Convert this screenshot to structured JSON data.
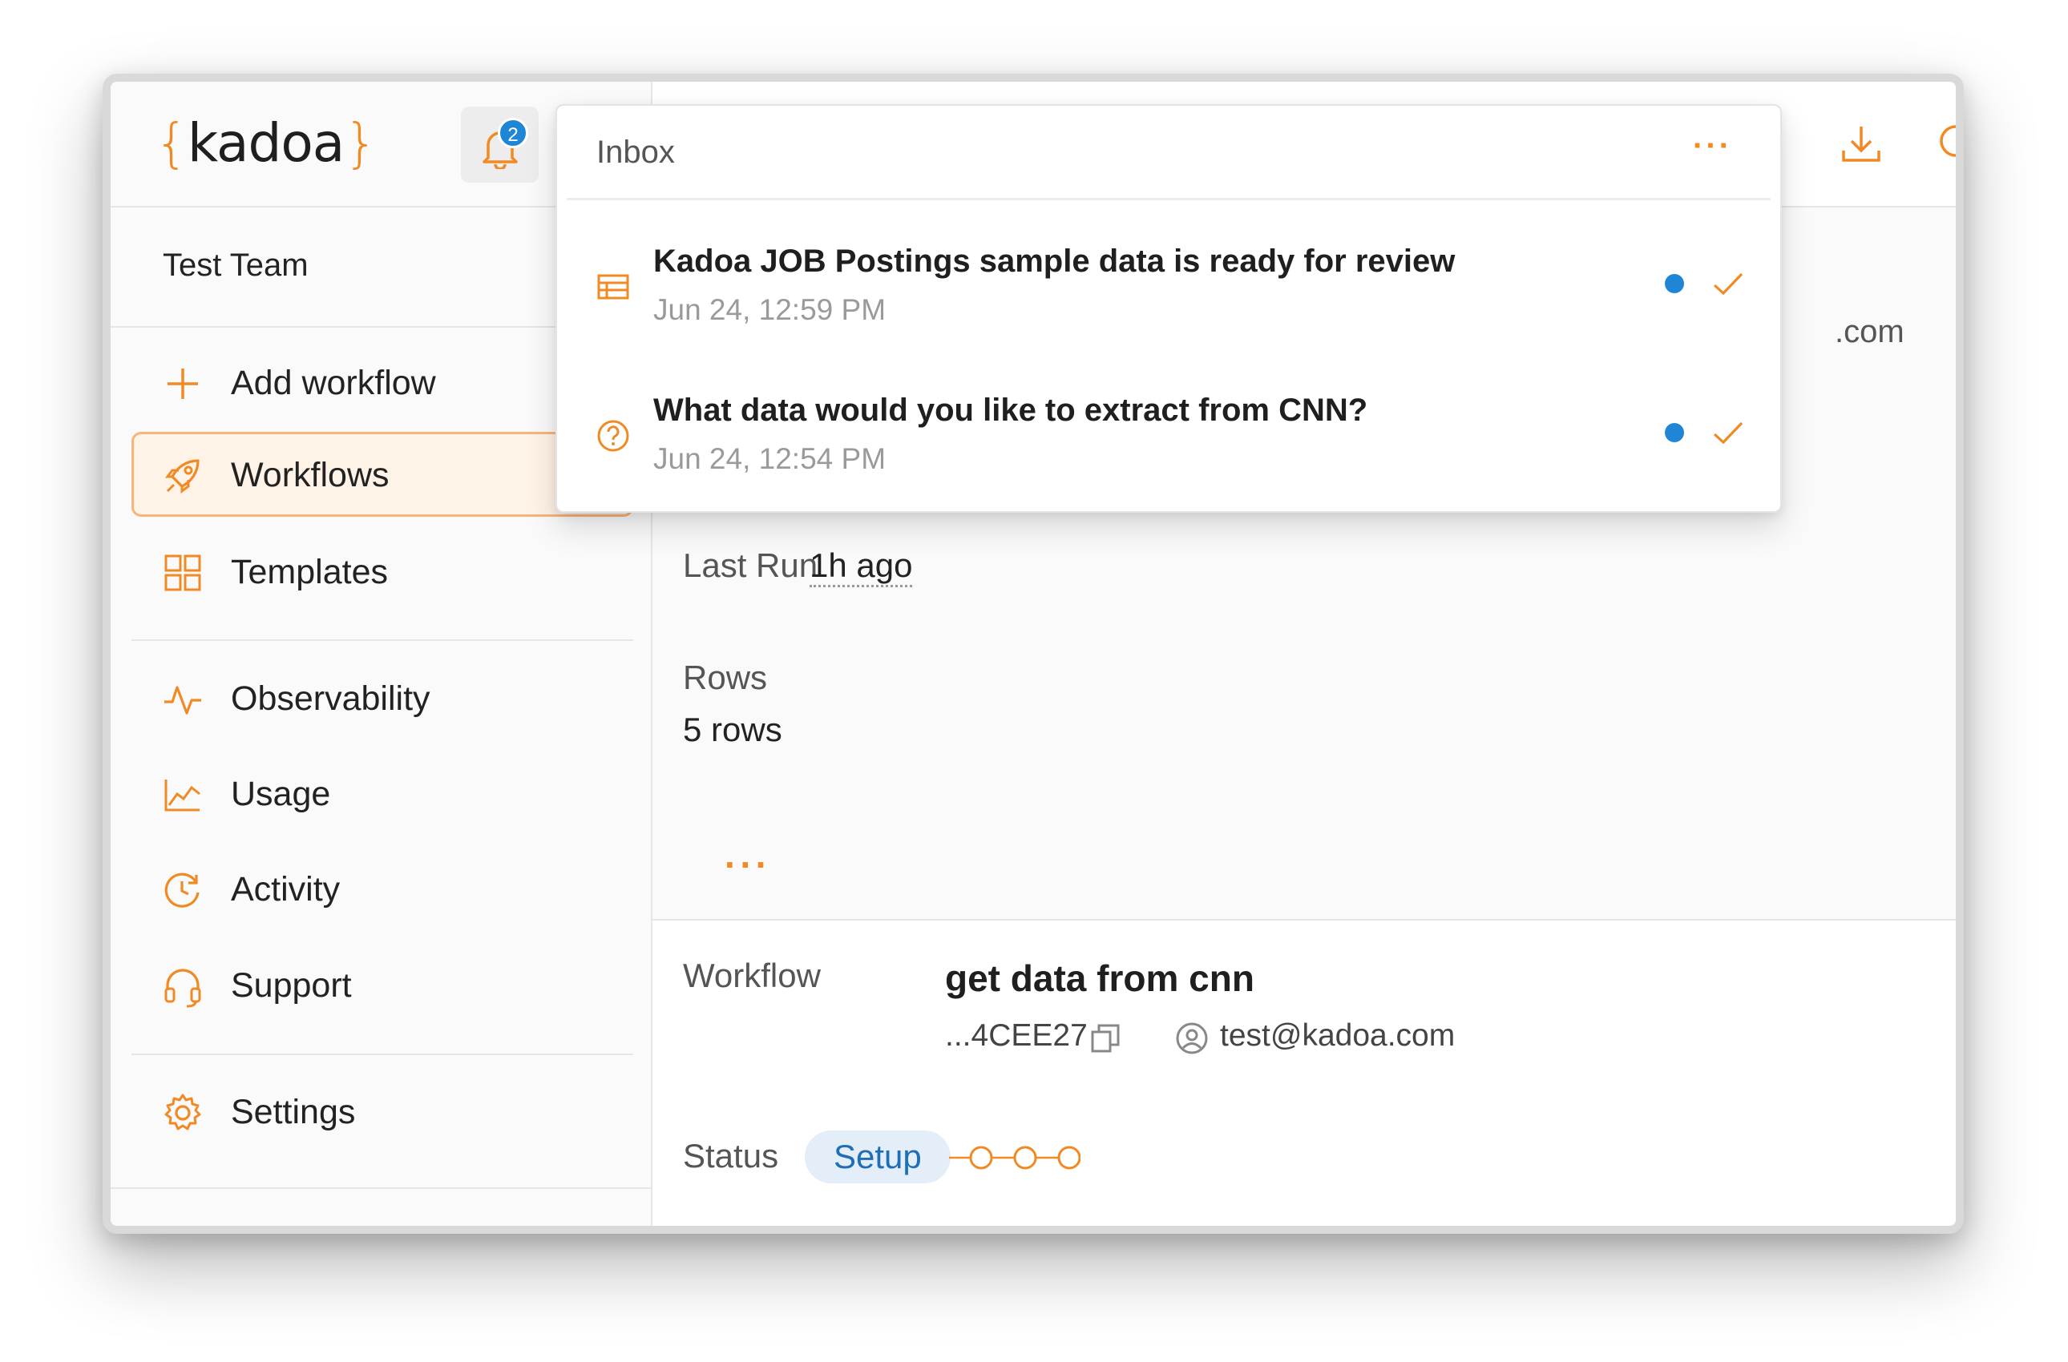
{
  "brand": {
    "name": "kadoa",
    "brace_open": "{",
    "brace_close": "}",
    "accent": "#f08a24"
  },
  "notifications_badge": "2",
  "team": "Test Team",
  "nav": {
    "add_workflow": "Add workflow",
    "workflows": "Workflows",
    "templates": "Templates",
    "observability": "Observability",
    "usage": "Usage",
    "activity": "Activity",
    "support": "Support",
    "settings": "Settings"
  },
  "inbox": {
    "title": "Inbox",
    "more": "···",
    "items": [
      {
        "title": "Kadoa JOB Postings sample data is ready for review",
        "time": "Jun 24, 12:59 PM",
        "icon": "table-icon",
        "unread": true
      },
      {
        "title": "What data would you like to extract from CNN?",
        "time": "Jun 24, 12:54 PM",
        "icon": "question-circle-icon",
        "unread": true
      }
    ]
  },
  "details": {
    "domain_fragment": ".com",
    "last_run_label": "Last Run",
    "last_run_value": "1h ago",
    "rows_label": "Rows",
    "rows_value": "5 rows",
    "more": "···"
  },
  "workflow": {
    "label": "Workflow",
    "name": "get data from cnn",
    "id": "...4CEE27",
    "owner": "test@kadoa.com",
    "status_label": "Status",
    "status": "Setup"
  }
}
